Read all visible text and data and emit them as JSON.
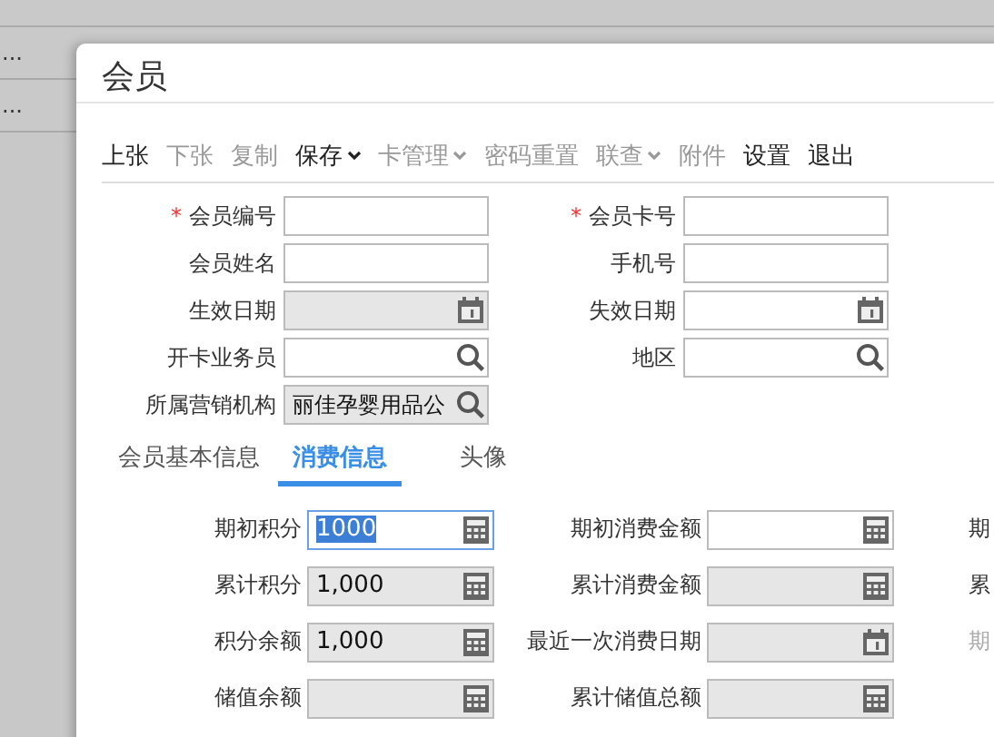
{
  "background_table": {
    "rows": [
      {
        "cell_1": "..."
      },
      {
        "cell_1": "..."
      }
    ]
  },
  "dialog": {
    "title": "会员"
  },
  "toolbar": [
    {
      "label": "上张",
      "disabled": false,
      "dropdown": false
    },
    {
      "label": "下张",
      "disabled": true,
      "dropdown": false
    },
    {
      "label": "复制",
      "disabled": true,
      "dropdown": false
    },
    {
      "label": "保存",
      "disabled": false,
      "dropdown": true
    },
    {
      "label": "卡管理",
      "disabled": true,
      "dropdown": true
    },
    {
      "label": "密码重置",
      "disabled": true,
      "dropdown": false
    },
    {
      "label": "联查",
      "disabled": true,
      "dropdown": true
    },
    {
      "label": "附件",
      "disabled": true,
      "dropdown": false
    },
    {
      "label": "设置",
      "disabled": false,
      "dropdown": false
    },
    {
      "label": "退出",
      "disabled": false,
      "dropdown": false
    }
  ],
  "header_fields": [
    [
      {
        "label": "会员编号",
        "required_mark": "*",
        "kind": "text",
        "disabled": false
      },
      {
        "label": "会员卡号",
        "required_mark": "*",
        "kind": "text",
        "disabled": false
      }
    ],
    [
      {
        "label": "会员姓名",
        "kind": "text",
        "disabled": false
      },
      {
        "label": "手机号",
        "kind": "text",
        "disabled": false
      }
    ],
    [
      {
        "label": "生效日期",
        "kind": "date",
        "disabled": true
      },
      {
        "label": "失效日期",
        "kind": "date",
        "disabled": false
      }
    ],
    [
      {
        "label": "开卡业务员",
        "kind": "lookup",
        "disabled": false
      },
      {
        "label": "地区",
        "kind": "lookup",
        "disabled": false
      }
    ],
    [
      {
        "label": "所属营销机构",
        "kind": "lookup",
        "disabled": true,
        "value": "丽佳孕婴用品公"
      }
    ]
  ],
  "tabs": [
    {
      "label": "会员基本信息",
      "selected": false
    },
    {
      "label": "消费信息",
      "selected": true
    },
    {
      "label": "头像",
      "selected": false
    }
  ],
  "consumption_fields": [
    {
      "fields": [
        {
          "label": "期初积分",
          "kind": "number",
          "disabled": false,
          "value": "1000",
          "focused": true
        },
        {
          "label": "期初消费金额",
          "kind": "number",
          "disabled": false,
          "focused": false
        }
      ],
      "column_3": {
        "label": "期",
        "disabled": false
      }
    },
    {
      "fields": [
        {
          "label": "累计积分",
          "kind": "number",
          "disabled": true,
          "value": "1,000",
          "focused": false
        },
        {
          "label": "累计消费金额",
          "kind": "number",
          "disabled": true,
          "focused": false
        }
      ],
      "column_3": {
        "label": "累",
        "disabled": false
      }
    },
    {
      "fields": [
        {
          "label": "积分余额",
          "kind": "number",
          "disabled": true,
          "value": "1,000",
          "focused": false
        },
        {
          "label": "最近一次消费日期",
          "kind": "date",
          "disabled": true,
          "focused": false
        }
      ],
      "column_3": {
        "label": "期",
        "disabled": true
      }
    },
    {
      "fields": [
        {
          "label": "储值余额",
          "kind": "number",
          "disabled": true,
          "focused": false
        },
        {
          "label": "累计储值总额",
          "kind": "number",
          "disabled": true,
          "focused": false
        }
      ]
    }
  ]
}
